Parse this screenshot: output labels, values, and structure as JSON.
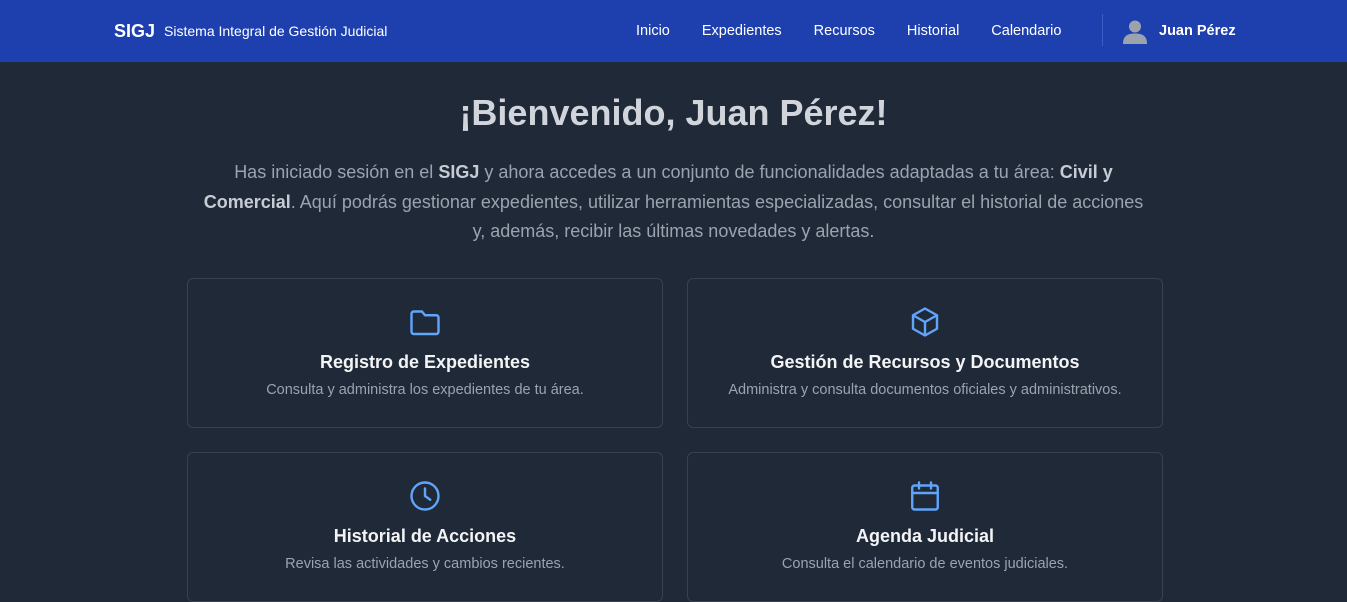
{
  "navbar": {
    "brand_abbr": "SIGJ",
    "brand_full": "Sistema Integral de Gestión Judicial",
    "links": [
      "Inicio",
      "Expedientes",
      "Recursos",
      "Historial",
      "Calendario"
    ],
    "user_name": "Juan Pérez",
    "user_icon": "user-avatar-icon"
  },
  "welcome": {
    "title": "¡Bienvenido, Juan Pérez!",
    "intro_1": "Has iniciado sesión en el ",
    "intro_sigj": "SIGJ",
    "intro_2": " y ahora accedes a un conjunto de funcionalidades adaptadas a tu área: ",
    "intro_area": "Civil y Comercial",
    "intro_3": ". Aquí podrás gestionar expedientes, utilizar herramientas especializadas, consultar el historial de acciones y, además, recibir las últimas novedades y alertas."
  },
  "cards": [
    {
      "icon": "folder-icon",
      "title": "Registro de Expedientes",
      "desc": "Consulta y administra los expedientes de tu área."
    },
    {
      "icon": "cube-icon",
      "title": "Gestión de Recursos y Documentos",
      "desc": "Administra y consulta documentos oficiales y administrativos."
    },
    {
      "icon": "clock-icon",
      "title": "Historial de Acciones",
      "desc": "Revisa las actividades y cambios recientes."
    },
    {
      "icon": "calendar-icon",
      "title": "Agenda Judicial",
      "desc": "Consulta el calendario de eventos judiciales."
    }
  ],
  "colors": {
    "navbar": "#1e40af",
    "background": "#1f2937",
    "icon_accent": "#60a5fa",
    "card_border": "#374151"
  }
}
